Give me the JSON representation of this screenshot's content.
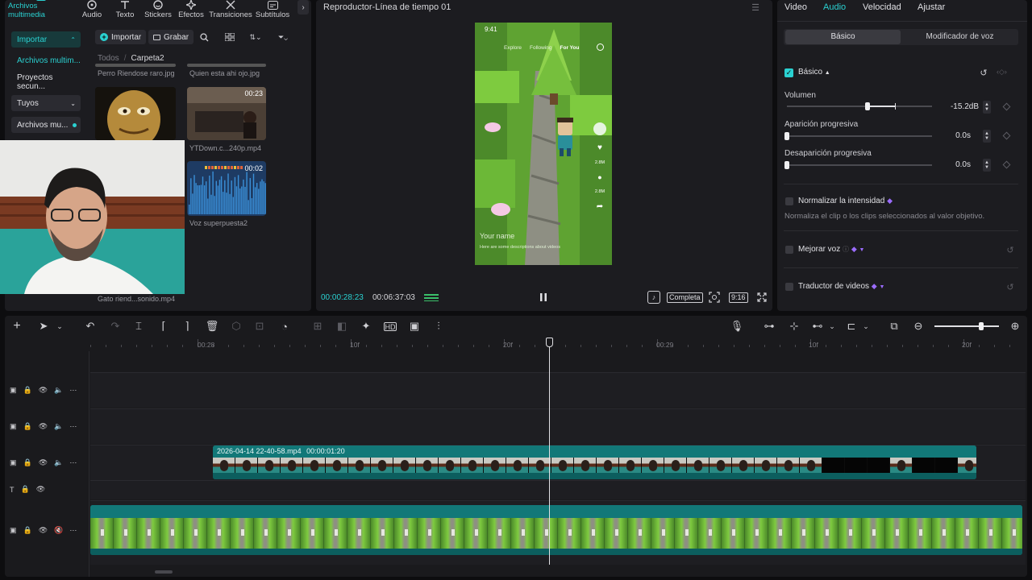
{
  "top_tabs": [
    {
      "label": "Archivos multimedia",
      "icon": "media-icon",
      "active": true
    },
    {
      "label": "Audio",
      "icon": "audio-icon",
      "active": false
    },
    {
      "label": "Texto",
      "icon": "text-icon",
      "active": false
    },
    {
      "label": "Stickers",
      "icon": "sticker-icon",
      "active": false
    },
    {
      "label": "Efectos",
      "icon": "effects-icon",
      "active": false
    },
    {
      "label": "Transiciones",
      "icon": "transition-icon",
      "active": false
    },
    {
      "label": "Subtítulos",
      "icon": "subtitles-icon",
      "active": false
    }
  ],
  "sidebar": {
    "import": "Importar",
    "items": [
      "Archivos multim...",
      "Proyectos secun...",
      "Tuyos",
      "Archivos mu..."
    ]
  },
  "media_toolbar": {
    "import": "Importar",
    "record": "Grabar"
  },
  "breadcrumb": {
    "root": "Todos",
    "sep": "/",
    "current": "Carpeta2"
  },
  "media_items": [
    {
      "caption": "Perro Riendose raro.jpg"
    },
    {
      "caption": "Quien esta ahi ojo.jpg"
    },
    {
      "caption": "",
      "duration": ""
    },
    {
      "caption": "YTDown.c...240p.mp4",
      "duration": "00:23"
    },
    {
      "caption": "Voz superpuesta2",
      "duration": "00:02"
    },
    {
      "caption": "Gato riend...sonido.mp4"
    }
  ],
  "player": {
    "title": "Reproductor-Línea de tiempo 01",
    "current_time": "00:00:28:23",
    "total_time": "00:06:37:03",
    "quality": "Completa",
    "ratio": "9:16",
    "phone": {
      "clock": "9:41",
      "tabs": [
        "Explore",
        "Following",
        "For You"
      ],
      "user": "Your name",
      "desc": "Here are some descriptions about videos",
      "counts": [
        "2.8M",
        "2.8M"
      ]
    }
  },
  "right_tabs": [
    "Video",
    "Audio",
    "Velocidad",
    "Ajustar"
  ],
  "right_active": "Audio",
  "subtabs": [
    "Básico",
    "Modificador de voz"
  ],
  "basic": {
    "label": "Básico",
    "volume_label": "Volumen",
    "volume_value": "-15.2dB",
    "volume_level": 0.74,
    "fade_in_label": "Aparición progresiva",
    "fade_in_value": "0.0s",
    "fade_out_label": "Desaparición progresiva",
    "fade_out_value": "0.0s"
  },
  "normalize": {
    "label": "Normalizar la intensidad",
    "desc": "Normaliza el clip o los clips seleccionados al valor objetivo."
  },
  "enhance_voice": "Mejorar voz",
  "video_translator": "Traductor de videos",
  "timeline": {
    "ruler": [
      "00:28",
      "10f",
      "20f",
      "00:29",
      "10f",
      "20f"
    ],
    "clip_name": "2026-04-14 22-40-58.mp4",
    "clip_duration": "00:00:01:20"
  },
  "colors": {
    "accent": "#2ad1d1",
    "clip": "#0f6f6f",
    "clip_top": "#127878",
    "panel": "#1c1c20"
  }
}
